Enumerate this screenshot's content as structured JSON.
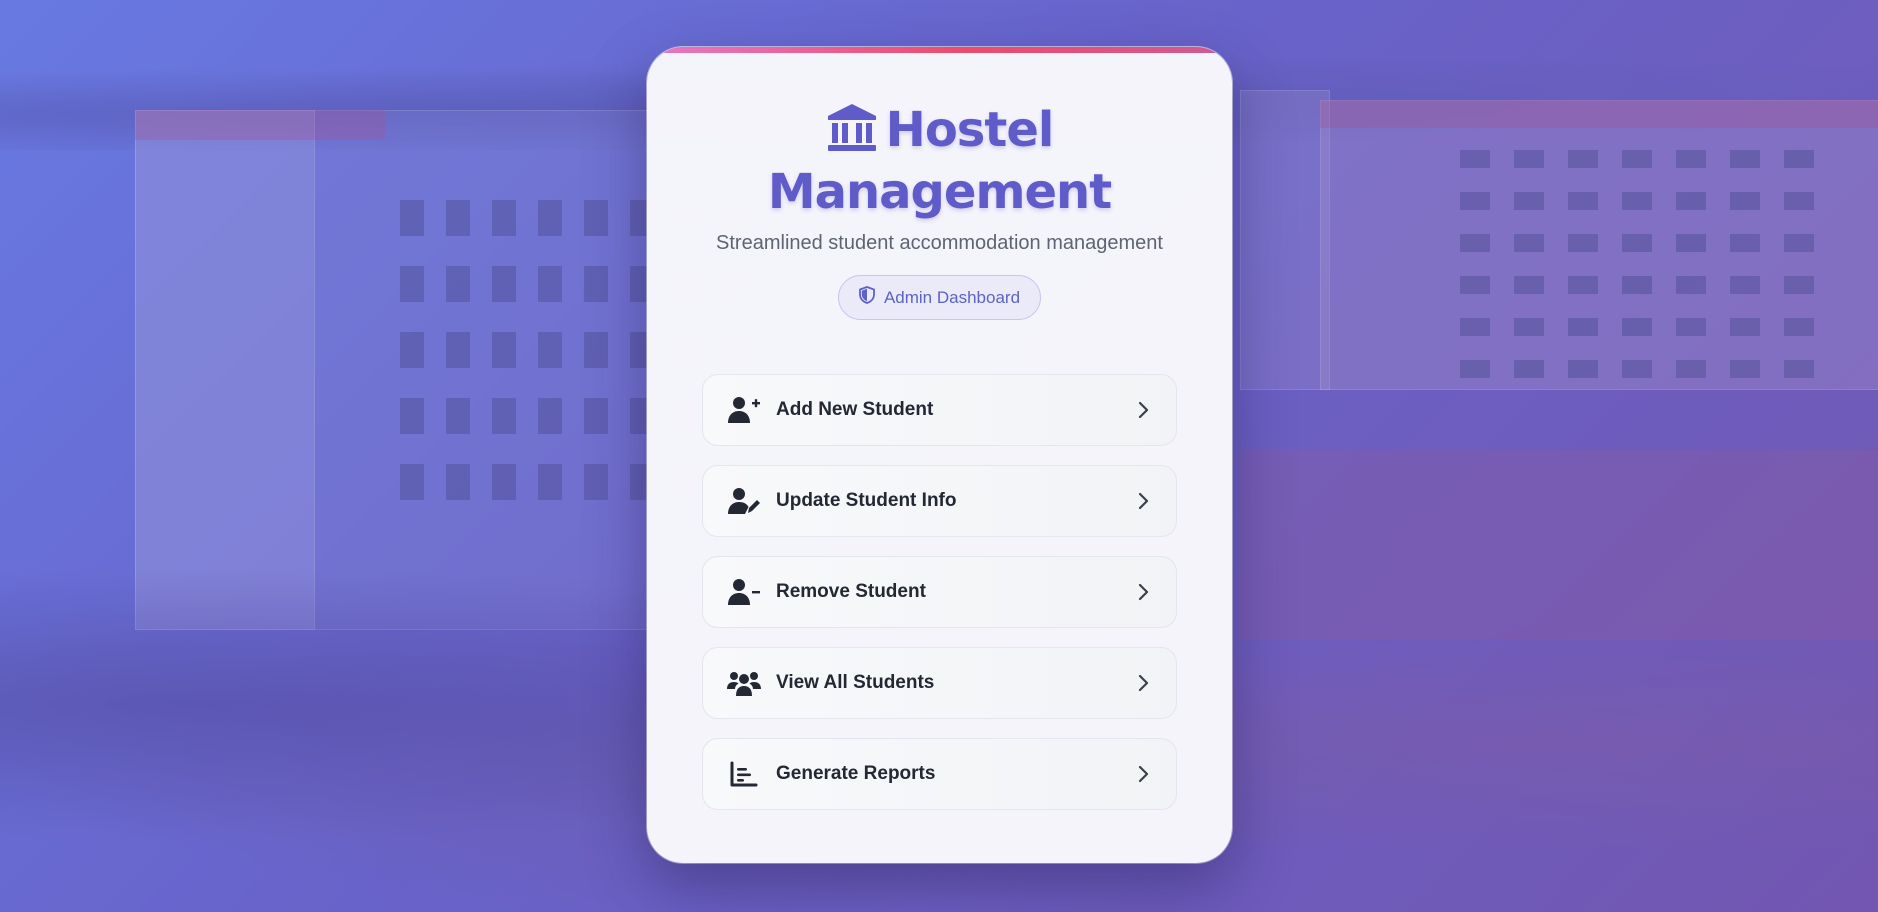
{
  "app": {
    "title_line1": "Hostel",
    "title_line2": "Management",
    "subtitle": "Streamlined student accommodation management",
    "badge": "Admin Dashboard"
  },
  "menu": [
    {
      "label": "Add New Student",
      "icon": "user-plus-icon"
    },
    {
      "label": "Update Student Info",
      "icon": "user-edit-icon"
    },
    {
      "label": "Remove Student",
      "icon": "user-minus-icon"
    },
    {
      "label": "View All Students",
      "icon": "users-icon"
    },
    {
      "label": "Generate Reports",
      "icon": "chart-bar-icon"
    }
  ],
  "colors": {
    "accent": "#5f5bc8",
    "badge_text": "#5d63c4",
    "item_text": "#232834",
    "top_gradient": [
      "#e678c4",
      "#ef4a6a",
      "#cf5a93"
    ]
  }
}
